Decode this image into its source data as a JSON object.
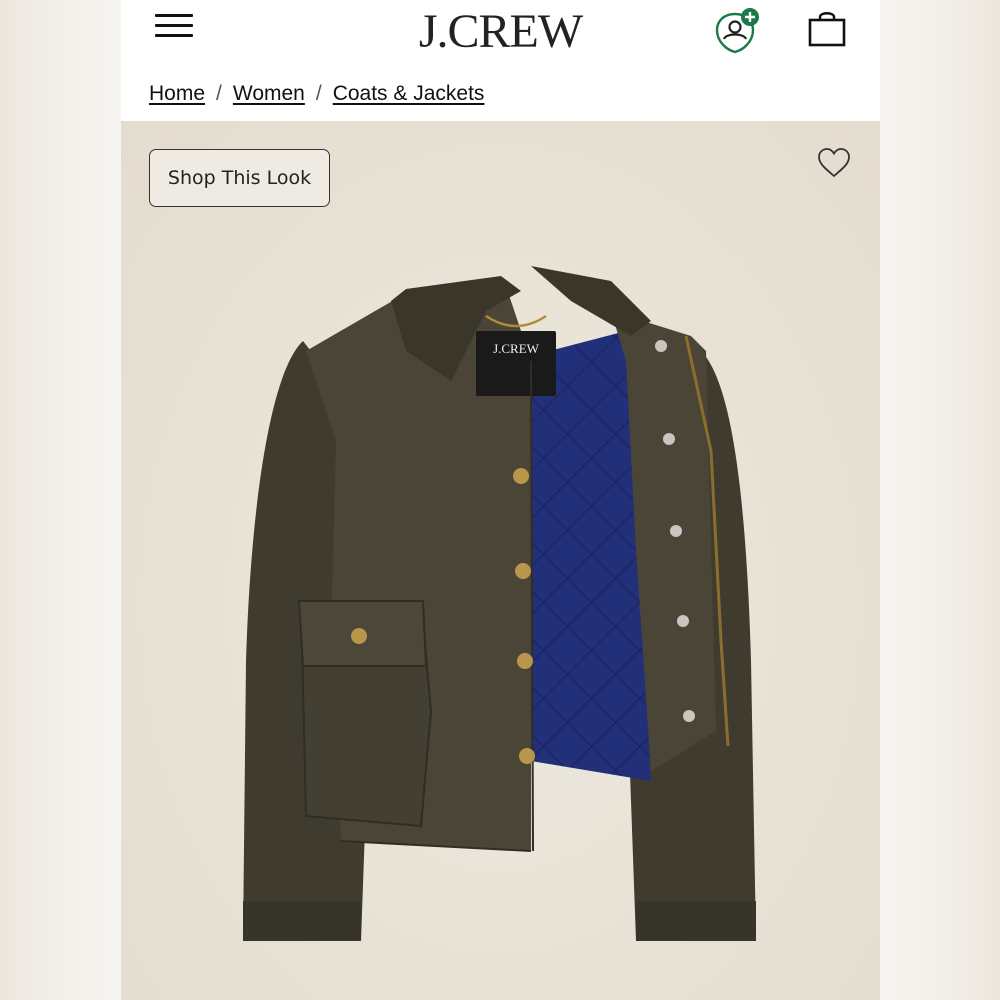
{
  "header": {
    "brand": "J.CREW",
    "menu_icon": "hamburger-menu-icon",
    "rewards_icon": "rewards-add-icon",
    "bag_icon": "shopping-bag-icon"
  },
  "breadcrumb": {
    "items": [
      "Home",
      "Women",
      "Coats & Jackets"
    ],
    "separator": "/"
  },
  "product": {
    "shop_look_label": "Shop This Look",
    "wishlist_icon": "heart-icon",
    "garment_label_brand": "J.CREW"
  },
  "colors": {
    "header_bg": "#ffffff",
    "image_bg": "#e9e3d8",
    "jacket": "#4a4537",
    "lining": "#1f2a66",
    "rewards_accent": "#1b7a45"
  }
}
